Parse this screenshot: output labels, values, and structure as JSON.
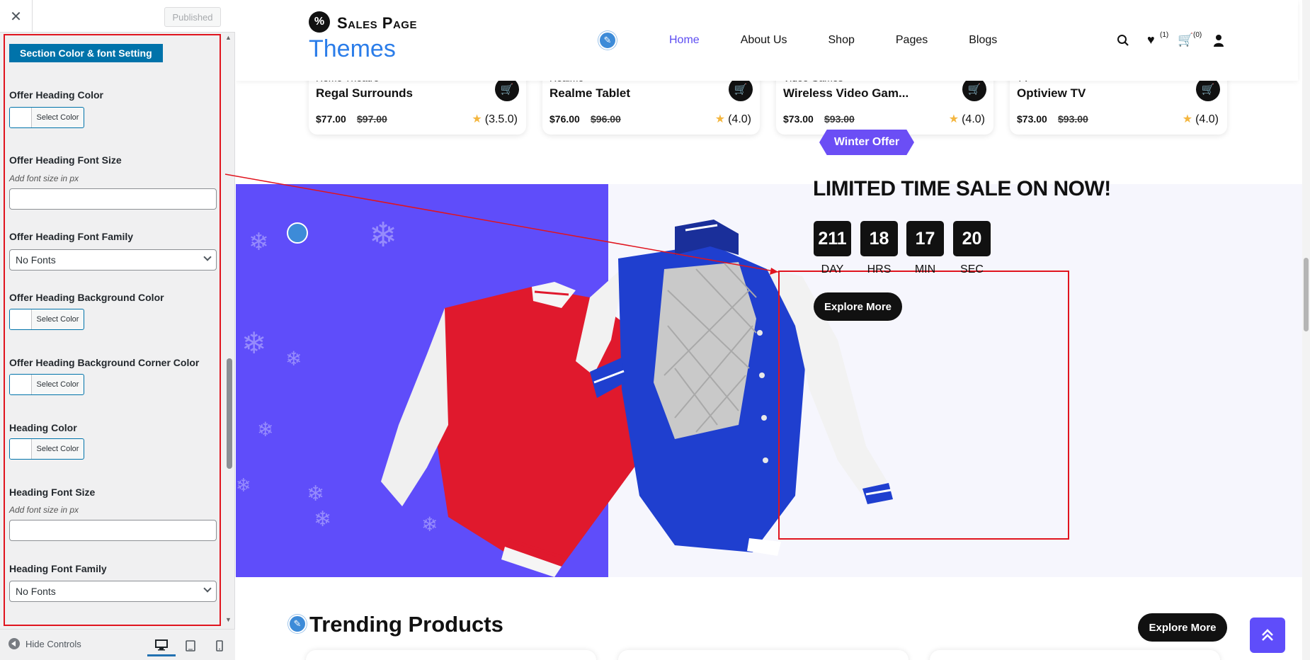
{
  "sidebar": {
    "close_glyph": "✕",
    "published_label": "Published",
    "section_title": "Section Color & font Setting",
    "color_button_label": "Select Color",
    "fields": {
      "offer_heading_color": "Offer Heading Color",
      "offer_heading_font_size": "Offer Heading Font Size",
      "offer_heading_font_size_hint": "Add font size in px",
      "offer_heading_font_family": "Offer Heading Font Family",
      "offer_heading_font_family_value": "No Fonts",
      "offer_heading_bg_color": "Offer Heading Background Color",
      "offer_heading_bg_corner_color": "Offer Heading Background Corner Color",
      "heading_color": "Heading Color",
      "heading_font_size": "Heading Font Size",
      "heading_font_size_hint": "Add font size in px",
      "heading_font_family": "Heading Font Family",
      "heading_font_family_value": "No Fonts"
    },
    "footer": {
      "hide_controls": "Hide Controls",
      "devices": [
        "desktop-icon",
        "tablet-icon",
        "mobile-icon"
      ]
    }
  },
  "site": {
    "logo_top": "Sales Page",
    "logo_bottom": "Themes",
    "logo_badge": "%",
    "nav": [
      "Home",
      "About Us",
      "Shop",
      "Pages",
      "Blogs"
    ],
    "wishlist_count": "(1)",
    "cart_count": "(0)",
    "colors": {
      "accent": "#5c4cf2",
      "logo_blue": "#2b7de9",
      "banner_bg": "#5f4dfa",
      "highlight_border": "#e0141e"
    }
  },
  "products": [
    {
      "category": "Home Theatre",
      "name": "Regal Surrounds",
      "price": "$77.00",
      "old_price": "$97.00",
      "rating": "(3.5.0)"
    },
    {
      "category": "Realme",
      "name": "Realme Tablet",
      "price": "$76.00",
      "old_price": "$96.00",
      "rating": "(4.0)"
    },
    {
      "category": "Video Games",
      "name": "Wireless Video Gam...",
      "price": "$73.00",
      "old_price": "$93.00",
      "rating": "(4.0)"
    },
    {
      "category": "TV",
      "name": "Optiview TV",
      "price": "$73.00",
      "old_price": "$93.00",
      "rating": "(4.0)"
    }
  ],
  "offer": {
    "tag": "Winter Offer",
    "heading": "LIMITED TIME SALE ON NOW!",
    "countdown": [
      {
        "value": "211",
        "unit": "DAY"
      },
      {
        "value": "18",
        "unit": "HRS"
      },
      {
        "value": "17",
        "unit": "MIN"
      },
      {
        "value": "20",
        "unit": "SEC"
      }
    ],
    "button": "Explore More"
  },
  "trending": {
    "title": "Trending Products",
    "button": "Explore More"
  }
}
